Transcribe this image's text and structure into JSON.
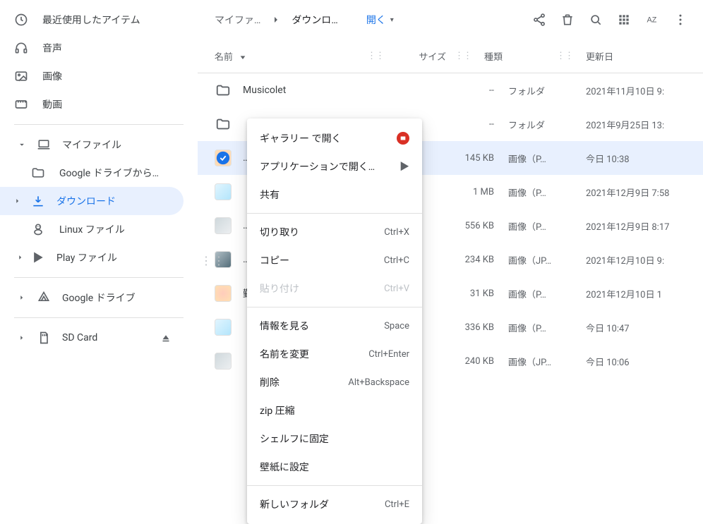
{
  "sidebar": {
    "recent": "最近使用したアイテム",
    "audio": "音声",
    "images": "画像",
    "videos": "動画",
    "myfiles": "マイファイル",
    "gdrive_from": "Google ドライブから…",
    "downloads": "ダウンロード",
    "linux": "Linux ファイル",
    "play": "Play ファイル",
    "gdrive": "Google ドライブ",
    "sdcard": "SD Card"
  },
  "toolbar": {
    "crumb1": "マイファ…",
    "crumb2": "ダウンロ…",
    "open_label": "開く"
  },
  "columns": {
    "name": "名前",
    "size": "サイズ",
    "type": "種類",
    "date": "更新日"
  },
  "rows": [
    {
      "name": "Musicolet",
      "size": "--",
      "type": "フォルダ",
      "date": "2021年11月10日 9:",
      "kind": "folder"
    },
    {
      "name": "",
      "size": "--",
      "type": "フォルダ",
      "date": "2021年9月25日 13:",
      "kind": "folder"
    },
    {
      "name": "…",
      "size": "145 KB",
      "type": "画像（P…",
      "date": "今日 10:38",
      "kind": "image",
      "selected": true
    },
    {
      "name": "",
      "size": "1 MB",
      "type": "画像（P…",
      "date": "2021年12月9日 7:58",
      "kind": "image"
    },
    {
      "name": "…",
      "size": "556 KB",
      "type": "画像（P…",
      "date": "2021年12月9日 8:17",
      "kind": "image"
    },
    {
      "name": "…",
      "size": "234 KB",
      "type": "画像（JP…",
      "date": "2021年12月10日 9:",
      "kind": "image"
    },
    {
      "name": "勤…",
      "size": "31 KB",
      "type": "画像（P…",
      "date": "2021年12月10日 1",
      "kind": "image"
    },
    {
      "name": "",
      "size": "336 KB",
      "type": "画像（P…",
      "date": "今日 10:47",
      "kind": "image"
    },
    {
      "name": "",
      "size": "240 KB",
      "type": "画像（JP…",
      "date": "今日 10:06",
      "kind": "image"
    }
  ],
  "context_menu": {
    "open_gallery": "ギャラリー で開く",
    "open_with": "アプリケーションで開く…",
    "share": "共有",
    "cut": "切り取り",
    "cut_accel": "Ctrl+X",
    "copy": "コピー",
    "copy_accel": "Ctrl+C",
    "paste": "貼り付け",
    "paste_accel": "Ctrl+V",
    "info": "情報を見る",
    "info_accel": "Space",
    "rename": "名前を変更",
    "rename_accel": "Ctrl+Enter",
    "delete": "削除",
    "delete_accel": "Alt+Backspace",
    "zip": "zip 圧縮",
    "pin_shelf": "シェルフに固定",
    "wallpaper": "壁紙に設定",
    "new_folder": "新しいフォルダ",
    "new_folder_accel": "Ctrl+E"
  }
}
